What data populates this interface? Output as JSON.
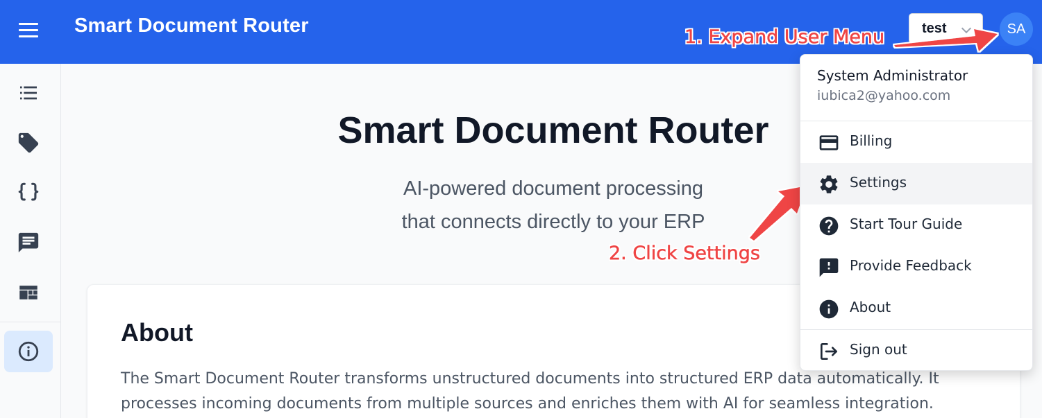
{
  "header": {
    "title": "Smart Document Router",
    "org_select_value": "test",
    "avatar_initials": "SA",
    "brand_color": "#2563eb"
  },
  "sidebar": {
    "items": [
      {
        "icon": "list-icon"
      },
      {
        "icon": "tag-icon"
      },
      {
        "icon": "curly-braces-icon"
      },
      {
        "icon": "chat-icon"
      },
      {
        "icon": "dashboard-icon"
      },
      {
        "icon": "info-icon",
        "active": true
      }
    ]
  },
  "main": {
    "hero_title": "Smart Document Router",
    "hero_subtitle_line1": "AI-powered document processing",
    "hero_subtitle_line2": "that connects directly to your ERP",
    "about_title": "About",
    "about_text": "The Smart Document Router transforms unstructured documents into structured ERP data automatically. It processes incoming documents from multiple sources and enriches them with AI for seamless integration."
  },
  "user_menu": {
    "name": "System Administrator",
    "email": "iubica2@yahoo.com",
    "items": [
      {
        "label": "Billing",
        "icon": "credit-card-icon"
      },
      {
        "label": "Settings",
        "icon": "gear-icon",
        "highlighted": true
      },
      {
        "label": "Start Tour Guide",
        "icon": "help-circle-icon"
      },
      {
        "label": "Provide Feedback",
        "icon": "feedback-icon"
      },
      {
        "label": "About",
        "icon": "info-icon"
      },
      {
        "label": "Sign out",
        "icon": "sign-out-icon"
      }
    ]
  },
  "annotations": {
    "step1": "1. Expand User Menu",
    "step2": "2. Click Settings",
    "color": "#ef4444"
  }
}
